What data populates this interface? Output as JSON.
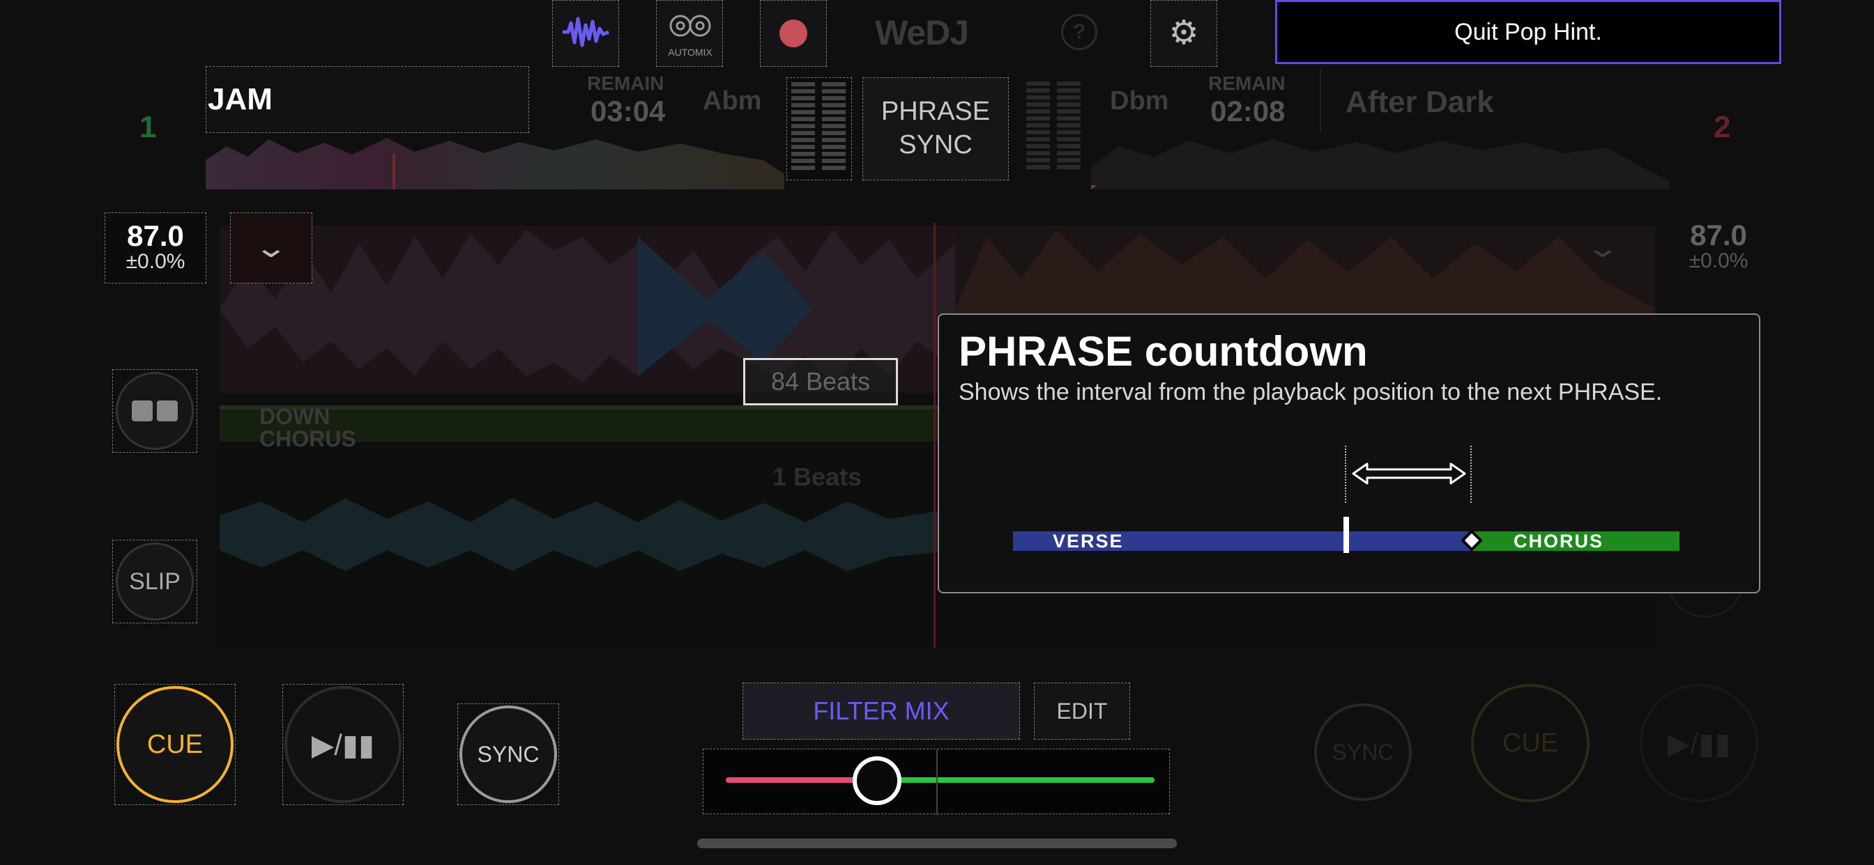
{
  "toolbar": {
    "waveform_icon": "waveform-icon",
    "automix_label": "AUTOMIX",
    "record_icon": "record-icon",
    "logo": "WeDJ",
    "help_icon": "help-icon",
    "settings_icon": "gear-icon",
    "quit_label": "Quit Pop Hint."
  },
  "deck1": {
    "number": "1",
    "title": "JAM",
    "remain_label": "REMAIN",
    "remain_time": "03:04",
    "key": "Abm",
    "bpm": "87.0",
    "pitch": "±0.0%",
    "phrase_labels": [
      "DOWN",
      "CHORUS"
    ],
    "beats_overlay": "84 Beats",
    "beats_secondary": "1 Beats"
  },
  "deck2": {
    "number": "2",
    "title": "After Dark",
    "remain_label": "REMAIN",
    "remain_time": "02:08",
    "key": "Dbm",
    "bpm": "87.0",
    "pitch": "±0.0%"
  },
  "center": {
    "phrase_sync_line1": "PHRASE",
    "phrase_sync_line2": "SYNC",
    "filter_mix": "FILTER MIX",
    "edit": "EDIT"
  },
  "hint_card": {
    "title": "PHRASE countdown",
    "description": "Shows the interval from the playback position to the next PHRASE.",
    "verse_label": "VERSE",
    "chorus_label": "CHORUS"
  },
  "transport": {
    "cue": "CUE",
    "play_pause": "▶/▮▮",
    "sync": "SYNC",
    "slip": "SLIP"
  },
  "colors": {
    "accent": "#6a5cf2",
    "cue": "#f5b32a",
    "verse": "#2e3a8f",
    "chorus": "#1d8a1d",
    "deck1": "#1f8a3a",
    "deck2": "#8a1f2a",
    "fader_left": "#e84a7a",
    "fader_right": "#28c83c"
  }
}
